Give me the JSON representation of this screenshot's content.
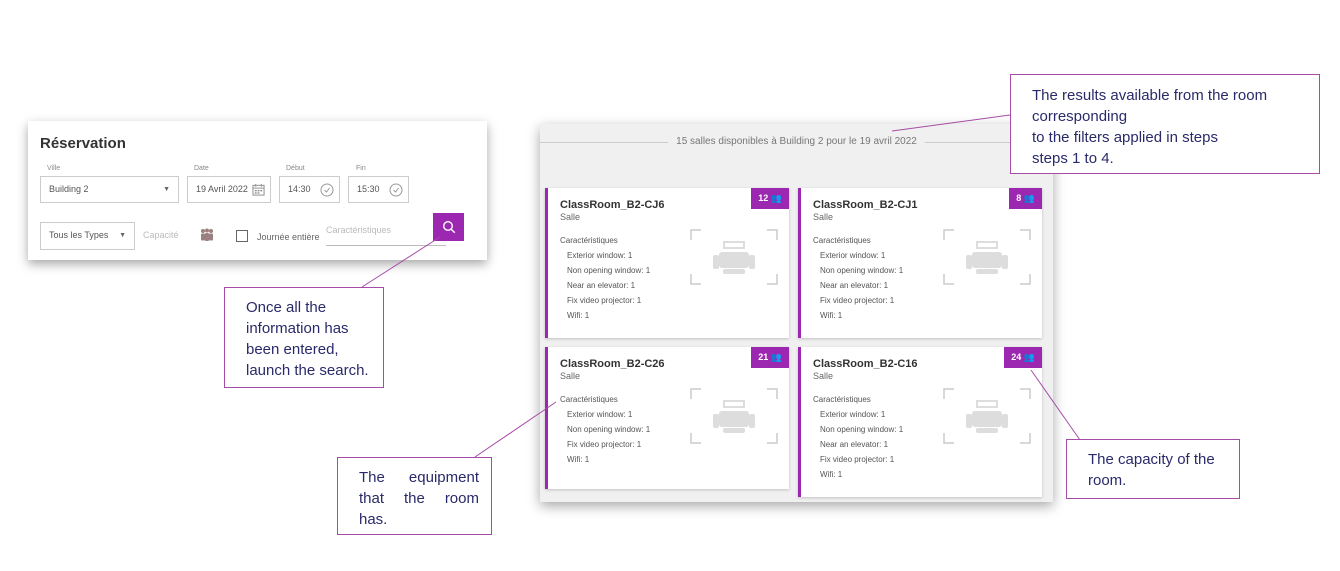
{
  "reservation": {
    "title": "Réservation",
    "ville_label": "Ville",
    "ville_value": "Building 2",
    "date_label": "Date",
    "date_value": "19 Avril 2022",
    "debut_label": "Début",
    "debut_value": "14:30",
    "fin_label": "Fin",
    "fin_value": "15:30",
    "type_value": "Tous les Types",
    "capacity_placeholder": "Capacité",
    "full_day_label": "Journée entière",
    "features_placeholder": "Caractéristiques",
    "accent_color": "#9c27b0"
  },
  "results": {
    "header": "15 salles disponibles à Building 2 pour le 19 avril 2022",
    "features_title": "Caractéristiques",
    "rooms": [
      {
        "name": "ClassRoom_B2-CJ6",
        "type": "Salle",
        "capacity": "12",
        "features": [
          "Exterior window: 1",
          "Non opening window: 1",
          "Near an elevator: 1",
          "Fix video projector: 1",
          "Wifi: 1"
        ]
      },
      {
        "name": "ClassRoom_B2-CJ1",
        "type": "Salle",
        "capacity": "8",
        "features": [
          "Exterior window: 1",
          "Non opening window: 1",
          "Near an elevator: 1",
          "Fix video projector: 1",
          "Wifi: 1"
        ]
      },
      {
        "name": "ClassRoom_B2-C26",
        "type": "Salle",
        "capacity": "21",
        "features": [
          "Exterior window: 1",
          "Non opening window: 1",
          "Fix video projector: 1",
          "Wifi: 1"
        ]
      },
      {
        "name": "ClassRoom_B2-C16",
        "type": "Salle",
        "capacity": "24",
        "features": [
          "Exterior window: 1",
          "Non opening window: 1",
          "Near an elevator: 1",
          "Fix video projector: 1",
          "Wifi: 1"
        ]
      }
    ]
  },
  "callouts": {
    "results": [
      "The results available from the room corresponding",
      "to the filters applied in steps",
      "steps 1 to 4."
    ],
    "search": [
      "Once all the",
      "information has",
      "been entered,",
      "launch the search."
    ],
    "equipment": [
      "The equipment",
      "that the room",
      "has."
    ],
    "capacity": [
      "The capacity of the",
      "room."
    ]
  },
  "icons": {
    "dropdown": "chevron-down-icon",
    "date": "calendar-icon",
    "time": "clock-icon",
    "capacity": "people-icon",
    "search": "search-icon",
    "room": "classroom-icon"
  }
}
